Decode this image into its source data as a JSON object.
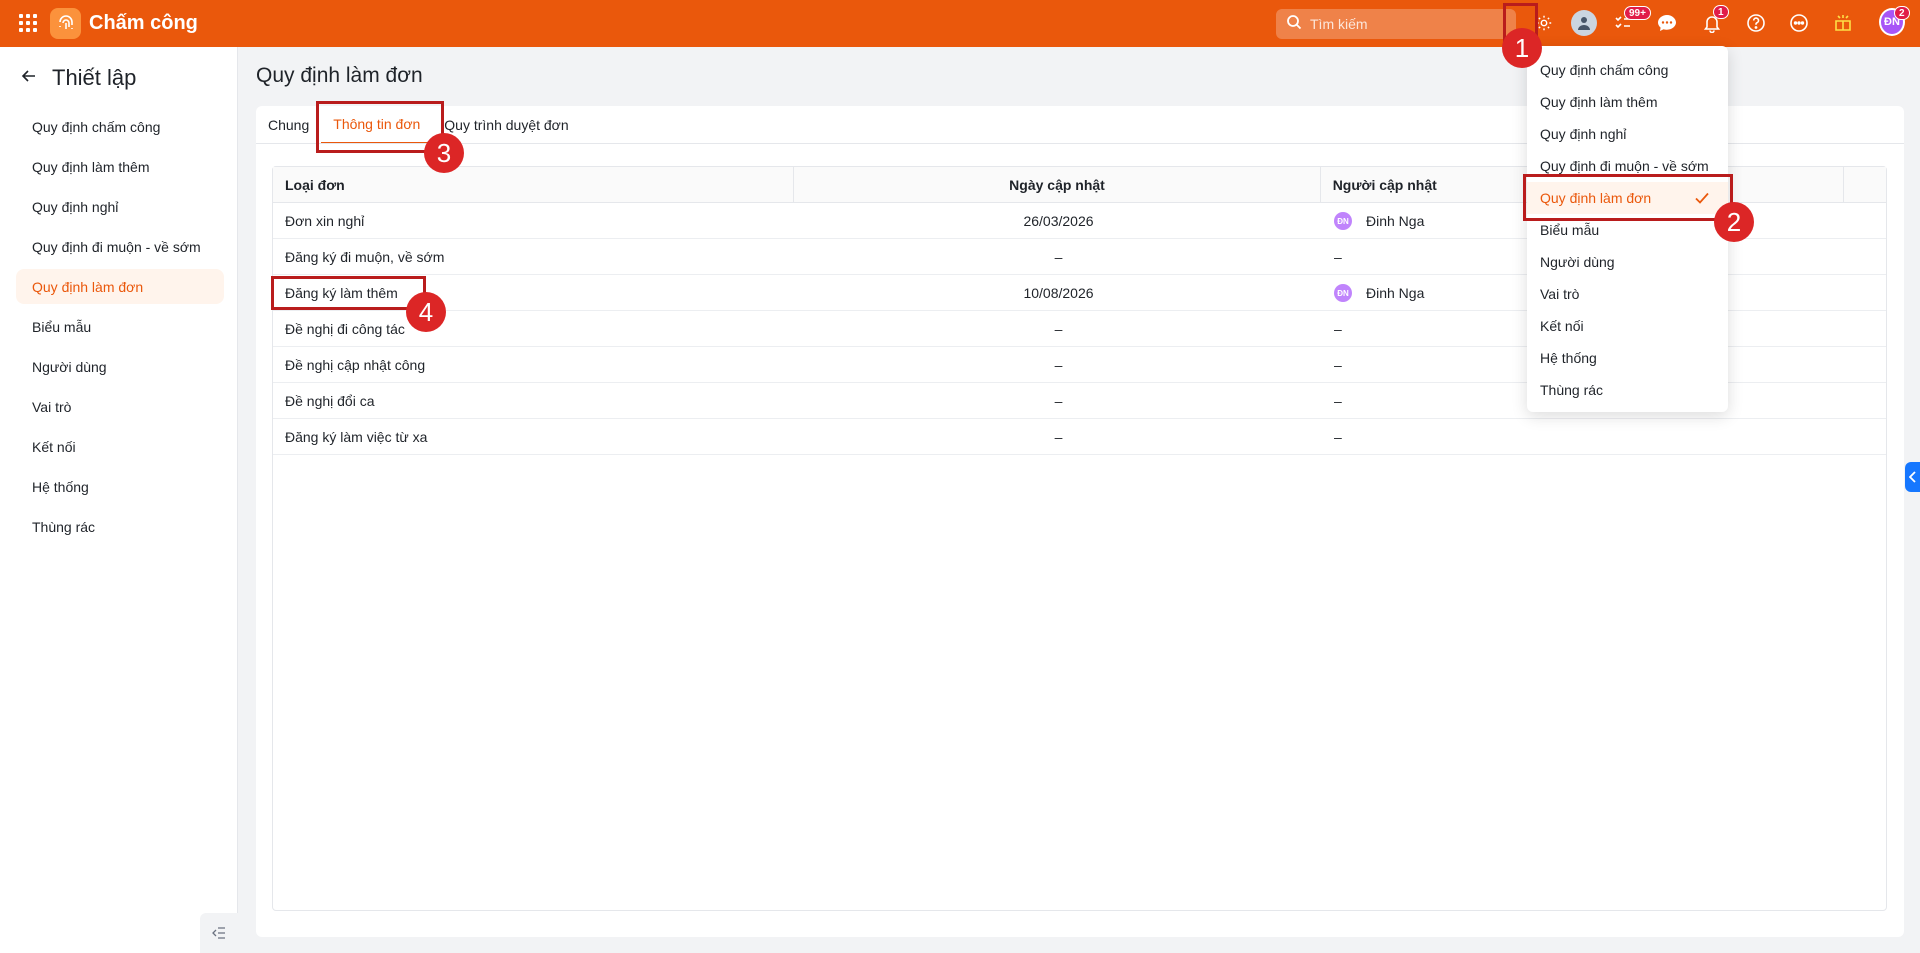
{
  "topbar": {
    "app_title": "Chấm công",
    "search_placeholder": "Tìm kiếm",
    "badges": {
      "tasks": "99+",
      "notifications": "1",
      "profile": "2"
    },
    "user_initials": "ĐN",
    "brand_color": "#ea580c"
  },
  "sidebar": {
    "title": "Thiết lập",
    "items": [
      {
        "label": "Quy định chấm công"
      },
      {
        "label": "Quy định làm thêm"
      },
      {
        "label": "Quy định nghỉ"
      },
      {
        "label": "Quy định đi muộn - về sớm"
      },
      {
        "label": "Quy định làm đơn",
        "active": true
      },
      {
        "label": "Biểu mẫu"
      },
      {
        "label": "Người dùng"
      },
      {
        "label": "Vai trò"
      },
      {
        "label": "Kết nối"
      },
      {
        "label": "Hệ thống"
      },
      {
        "label": "Thùng rác"
      }
    ]
  },
  "main": {
    "page_title": "Quy định làm đơn",
    "tabs": [
      {
        "label": "Chung"
      },
      {
        "label": "Thông tin đơn",
        "active": true
      },
      {
        "label": "Quy trình duyệt đơn"
      }
    ],
    "table": {
      "headers": [
        "Loại đơn",
        "Ngày cập nhật",
        "Người cập nhật"
      ],
      "rows": [
        {
          "type": "Đơn xin nghỉ",
          "date": "26/03/2026",
          "user": "Đinh Nga",
          "initials": "ĐN"
        },
        {
          "type": "Đăng ký đi muộn, về sớm",
          "date": "–",
          "user": "–"
        },
        {
          "type": "Đăng ký làm thêm",
          "date": "10/08/2026",
          "user": "Đinh Nga",
          "initials": "ĐN"
        },
        {
          "type": "Đề nghị đi công tác",
          "date": "–",
          "user": "–"
        },
        {
          "type": "Đề nghị cập nhật công",
          "date": "–",
          "user": "–"
        },
        {
          "type": "Đề nghị đổi ca",
          "date": "–",
          "user": "–"
        },
        {
          "type": "Đăng ký làm việc từ xa",
          "date": "–",
          "user": "–"
        }
      ]
    }
  },
  "dropdown": {
    "items": [
      {
        "label": "Quy định chấm công"
      },
      {
        "label": "Quy định làm thêm"
      },
      {
        "label": "Quy định nghỉ"
      },
      {
        "label": "Quy định đi muộn - về sớm"
      },
      {
        "label": "Quy định làm đơn",
        "active": true
      },
      {
        "label": "Biểu mẫu"
      },
      {
        "label": "Người dùng"
      },
      {
        "label": "Vai trò"
      },
      {
        "label": "Kết nối"
      },
      {
        "label": "Hệ thống"
      },
      {
        "label": "Thùng rác"
      }
    ]
  },
  "annotations": [
    "1",
    "2",
    "3",
    "4"
  ]
}
